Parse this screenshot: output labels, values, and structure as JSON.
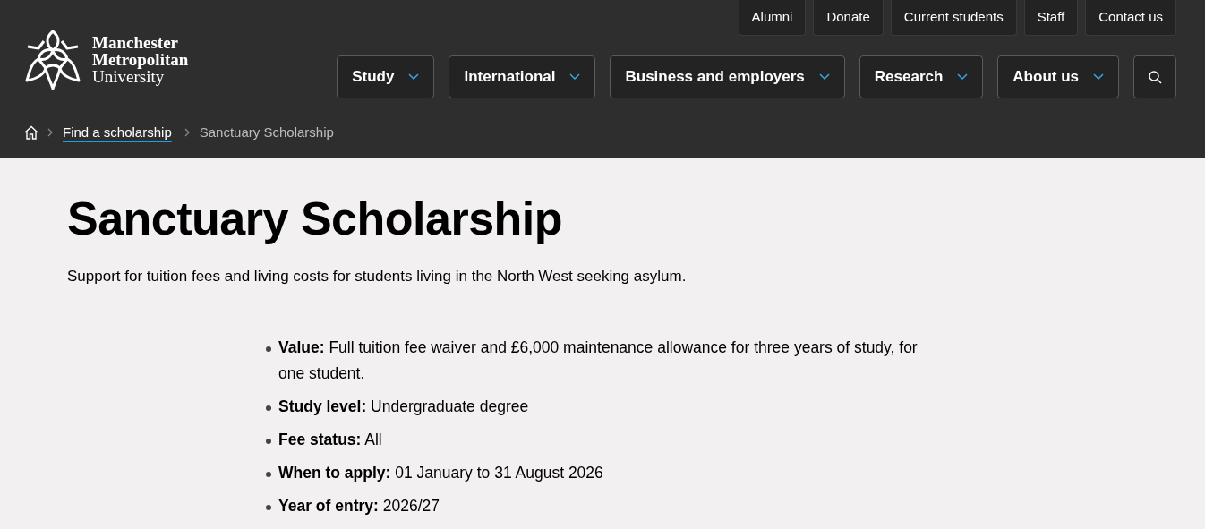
{
  "logo": {
    "lines": [
      "Manchester",
      "Metropolitan",
      "University"
    ]
  },
  "utility_nav": [
    "Alumni",
    "Donate",
    "Current students",
    "Staff",
    "Contact us"
  ],
  "main_nav": [
    {
      "label": "Study",
      "expanded": false
    },
    {
      "label": "International",
      "expanded": false
    },
    {
      "label": "Business and employers",
      "expanded": false
    },
    {
      "label": "Research",
      "expanded": false
    },
    {
      "label": "About us",
      "expanded": false
    }
  ],
  "breadcrumb": {
    "link": "Find a scholarship",
    "current": "Sanctuary Scholarship"
  },
  "title": "Sanctuary Scholarship",
  "intro": "Support for tuition fees and living costs for students living in the North West seeking asylum.",
  "details": [
    "**Value:** Full tuition fee waiver and £6,000 maintenance allowance for three years of study, for one student.",
    "**Study level:** Undergraduate degree",
    "**Fee status:** All",
    "**When to apply:** 01 January  to  31 August 2026",
    "**Year of entry:** 2026/27"
  ]
}
